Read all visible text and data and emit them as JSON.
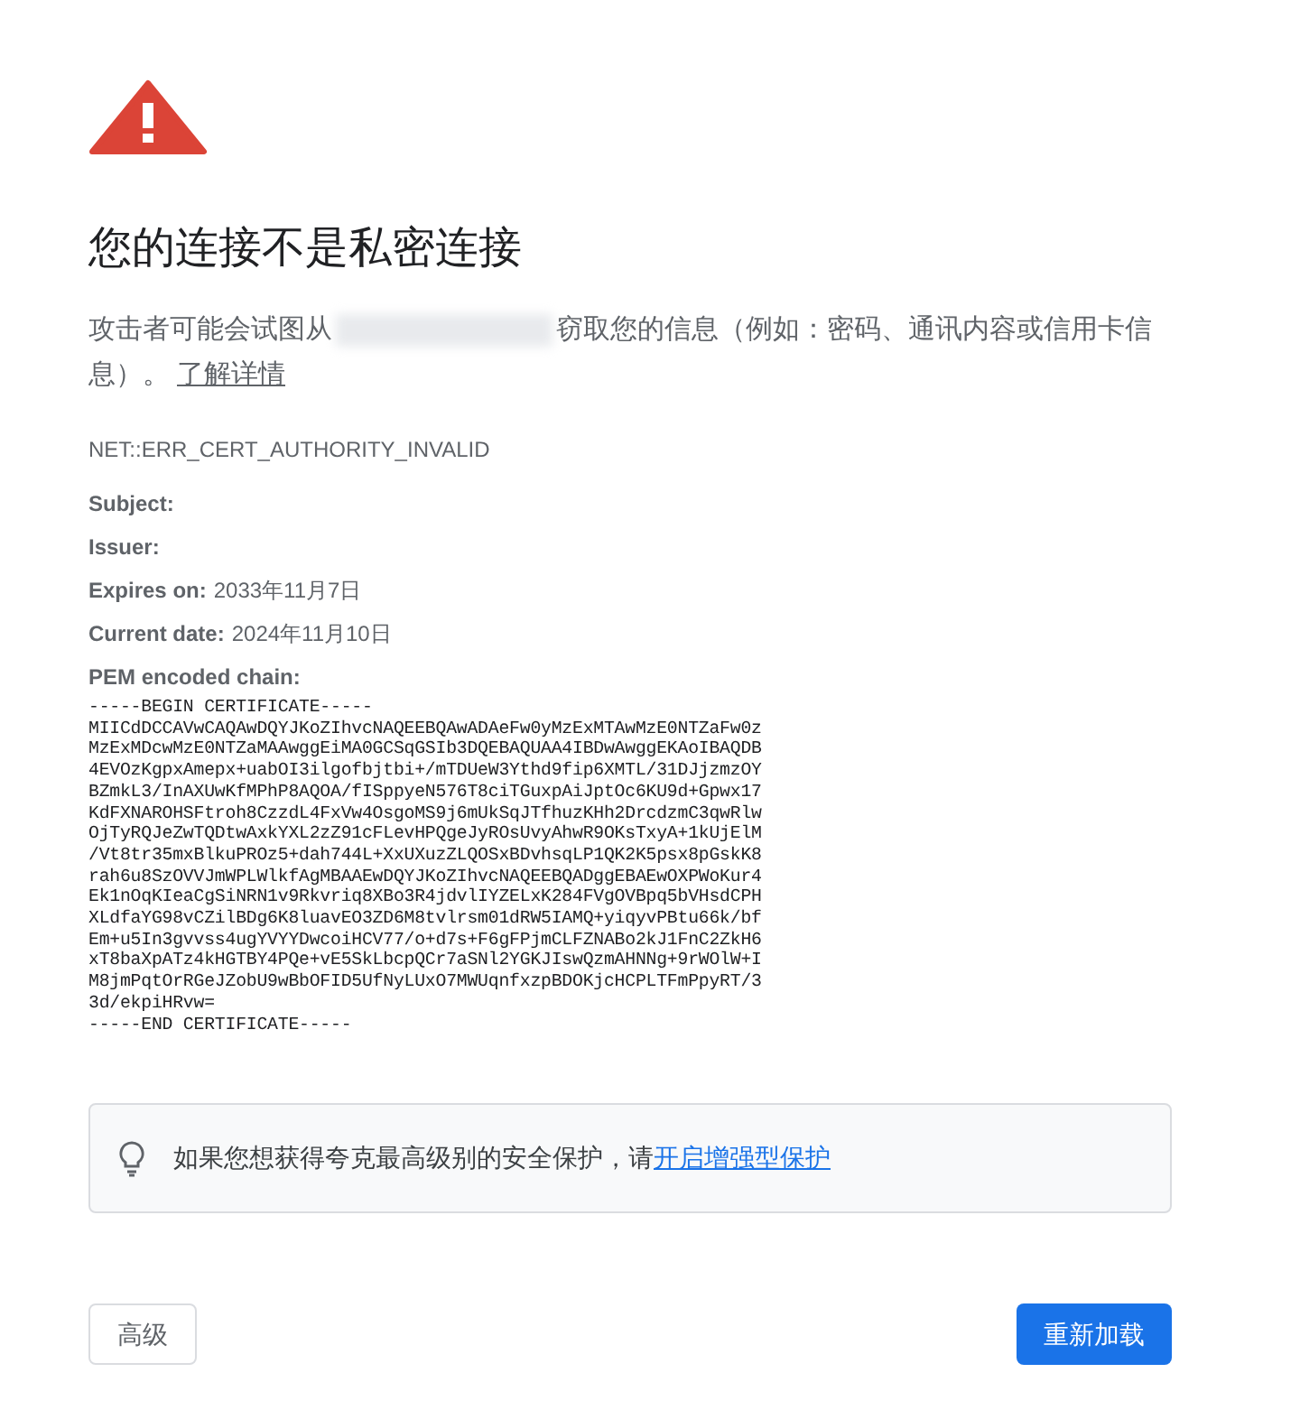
{
  "heading": "您的连接不是私密连接",
  "message": {
    "before": "攻击者可能会试图从",
    "after": "窃取您的信息（例如：密码、通讯内容或信用卡信息）。",
    "link": "了解详情"
  },
  "error_code": "NET::ERR_CERT_AUTHORITY_INVALID",
  "details": [
    {
      "label": "Subject:"
    },
    {
      "label": "Issuer:"
    },
    {
      "label": "Expires on:",
      "value": "2033年11月7日"
    },
    {
      "label": "Current date:",
      "value": "2024年11月10日"
    }
  ],
  "pem_label": "PEM encoded chain:",
  "certificate": [
    "-----BEGIN CERTIFICATE-----",
    "MIICdDCCAVwCAQAwDQYJKoZIhvcNAQEEBQAwADAeFw0yMzExMTAwMzE0NTZaFw0z",
    "MzExMDcwMzE0NTZaMAAwggEiMA0GCSqGSIb3DQEBAQUAA4IBDwAwggEKAoIBAQDB",
    "4EVOzKgpxAmepx+uabOI3ilgofbjtbi+/mTDUeW3Ythd9fip6XMTL/31DJjzmzOY",
    "BZmkL3/InAXUwKfMPhP8AQOA/fISppyeN576T8ciTGuxpAiJptOc6KU9d+Gpwx17",
    "KdFXNAROHSFtroh8CzzdL4FxVw4OsgoMS9j6mUkSqJTfhuzKHh2DrcdzmC3qwRlw",
    "OjTyRQJeZwTQDtwAxkYXL2zZ91cFLevHPQgeJyROsUvyAhwR9OKsTxyA+1kUjElM",
    "/Vt8tr35mxBlkuPROz5+dah744L+XxUXuzZLQOSxBDvhsqLP1QK2K5psx8pGskK8",
    "rah6u8SzOVVJmWPLWlkfAgMBAAEwDQYJKoZIhvcNAQEEBQADggEBAEwOXPWoKur4",
    "Ek1nOqKIeaCgSiNRN1v9Rkvriq8XBo3R4jdvlIYZELxK284FVgOVBpq5bVHsdCPH",
    "XLdfaYG98vCZilBDg6K8luavEO3ZD6M8tvlrsm01dRW5IAMQ+yiqyvPBtu66k/bf",
    "Em+u5In3gvvss4ugYVYYDwcoiHCV77/o+d7s+F6gFPjmCLFZNABo2kJ1FnC2ZkH6",
    "xT8baXpATz4kHGTBY4PQe+vE5SkLbcpQCr7aSNl2YGKJIswQzmAHNNg+9rWOlW+I",
    "M8jmPqtOrRGeJZobU9wBbOFID5UfNyLUxO7MWUqnfxzpBDOKjcHCPLTFmPpyRT/3",
    "3d/ekpiHRvw=",
    "-----END CERTIFICATE-----"
  ],
  "tip": {
    "text": "如果您想获得夸克最高级别的安全保护，请",
    "link": "开启增强型保护"
  },
  "buttons": [
    {
      "label": "高级",
      "kind": "secondary"
    },
    {
      "label": "重新加载",
      "kind": "primary"
    }
  ]
}
